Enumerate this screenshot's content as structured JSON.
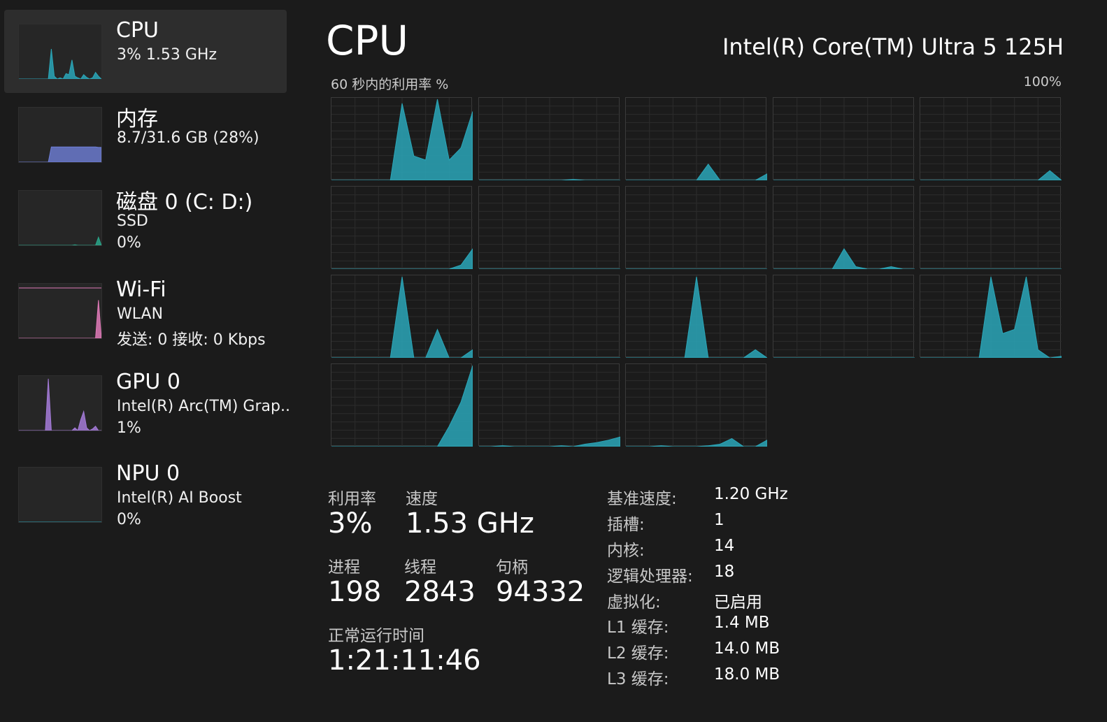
{
  "sidebar": {
    "items": [
      {
        "title": "CPU",
        "lines": [
          "3% 1.53 GHz"
        ],
        "color": "#2aa6b8",
        "selected": true
      },
      {
        "title": "内存",
        "lines": [
          "8.7/31.6 GB (28%)"
        ],
        "color": "#6f7fd8",
        "selected": false
      },
      {
        "title": "磁盘 0 (C: D:)",
        "lines": [
          "SSD",
          "0%"
        ],
        "color": "#2aa68a",
        "selected": false
      },
      {
        "title": "Wi-Fi",
        "lines": [
          "WLAN",
          "发送: 0 接收: 0 Kbps"
        ],
        "color": "#e07ab8",
        "selected": false
      },
      {
        "title": "GPU 0",
        "lines": [
          "Intel(R) Arc(TM) Grap..",
          "1%"
        ],
        "color": "#a47bd8",
        "selected": false
      },
      {
        "title": "NPU 0",
        "lines": [
          "Intel(R) AI Boost",
          "0%"
        ],
        "color": "#2aa6b8",
        "selected": false
      }
    ]
  },
  "main": {
    "title": "CPU",
    "processor": "Intel(R) Core(TM) Ultra 5 125H",
    "graph_label": "60 秒内的利用率 %",
    "graph_max": "100%",
    "accent_color": "#2aa6b8"
  },
  "stats": {
    "utilization": {
      "label": "利用率",
      "value": "3%"
    },
    "speed": {
      "label": "速度",
      "value": "1.53 GHz"
    },
    "processes": {
      "label": "进程",
      "value": "198"
    },
    "threads": {
      "label": "线程",
      "value": "2843"
    },
    "handles": {
      "label": "句柄",
      "value": "94332"
    },
    "uptime": {
      "label": "正常运行时间",
      "value": "1:21:11:46"
    }
  },
  "specs": [
    {
      "label": "基准速度:",
      "value": "1.20 GHz"
    },
    {
      "label": "插槽:",
      "value": "1"
    },
    {
      "label": "内核:",
      "value": "14"
    },
    {
      "label": "逻辑处理器:",
      "value": "18"
    },
    {
      "label": "虚拟化:",
      "value": "已启用"
    },
    {
      "label": "L1 缓存:",
      "value": "1.4 MB"
    },
    {
      "label": "L2 缓存:",
      "value": "14.0 MB"
    },
    {
      "label": "L3 缓存:",
      "value": "18.0 MB"
    }
  ],
  "chart_data": {
    "type": "area",
    "title": "60 秒内的利用率 %",
    "ylim": [
      0,
      100
    ],
    "x": [
      0,
      5,
      10,
      15,
      20,
      25,
      30,
      35,
      40,
      45,
      50,
      55,
      60
    ],
    "series": [
      {
        "values": [
          0,
          0,
          0,
          0,
          0,
          0,
          95,
          30,
          25,
          100,
          25,
          40,
          85
        ]
      },
      {
        "values": [
          0,
          0,
          0,
          0,
          0,
          0,
          0,
          0,
          1,
          0,
          0,
          0,
          0
        ]
      },
      {
        "values": [
          0,
          0,
          0,
          0,
          0,
          0,
          0,
          20,
          0,
          0,
          0,
          0,
          8
        ]
      },
      {
        "values": [
          0,
          0,
          0,
          0,
          0,
          0,
          0,
          0,
          0,
          0,
          0,
          0,
          0
        ]
      },
      {
        "values": [
          0,
          0,
          0,
          0,
          0,
          0,
          0,
          0,
          0,
          0,
          0,
          12,
          0
        ]
      },
      {
        "values": [
          0,
          0,
          0,
          0,
          0,
          0,
          0,
          0,
          0,
          0,
          0,
          5,
          25
        ]
      },
      {
        "values": [
          0,
          0,
          0,
          0,
          0,
          0,
          0,
          0,
          0,
          0,
          0,
          0,
          0
        ]
      },
      {
        "values": [
          0,
          0,
          0,
          0,
          0,
          0,
          0,
          0,
          0,
          0,
          0,
          0,
          0
        ]
      },
      {
        "values": [
          0,
          0,
          0,
          0,
          0,
          0,
          25,
          3,
          0,
          0,
          3,
          0,
          0
        ]
      },
      {
        "values": [
          0,
          0,
          0,
          0,
          0,
          0,
          0,
          0,
          0,
          0,
          0,
          0,
          0
        ]
      },
      {
        "values": [
          0,
          0,
          0,
          0,
          0,
          0,
          100,
          0,
          0,
          35,
          0,
          0,
          10
        ]
      },
      {
        "values": [
          0,
          0,
          0,
          0,
          0,
          0,
          0,
          0,
          0,
          0,
          0,
          0,
          0
        ]
      },
      {
        "values": [
          0,
          0,
          0,
          0,
          0,
          0,
          100,
          0,
          0,
          0,
          0,
          10,
          0
        ]
      },
      {
        "values": [
          0,
          0,
          0,
          0,
          0,
          0,
          0,
          0,
          0,
          0,
          0,
          0,
          0
        ]
      },
      {
        "values": [
          0,
          0,
          0,
          0,
          0,
          0,
          100,
          30,
          35,
          100,
          10,
          0,
          2
        ]
      },
      {
        "values": [
          0,
          0,
          0,
          0,
          0,
          0,
          0,
          0,
          0,
          0,
          25,
          55,
          100
        ]
      },
      {
        "values": [
          0,
          0,
          1,
          0,
          0,
          0,
          0,
          1,
          0,
          3,
          5,
          8,
          12
        ]
      },
      {
        "values": [
          0,
          0,
          0,
          1,
          0,
          0,
          0,
          1,
          3,
          10,
          0,
          0,
          8
        ]
      }
    ]
  }
}
